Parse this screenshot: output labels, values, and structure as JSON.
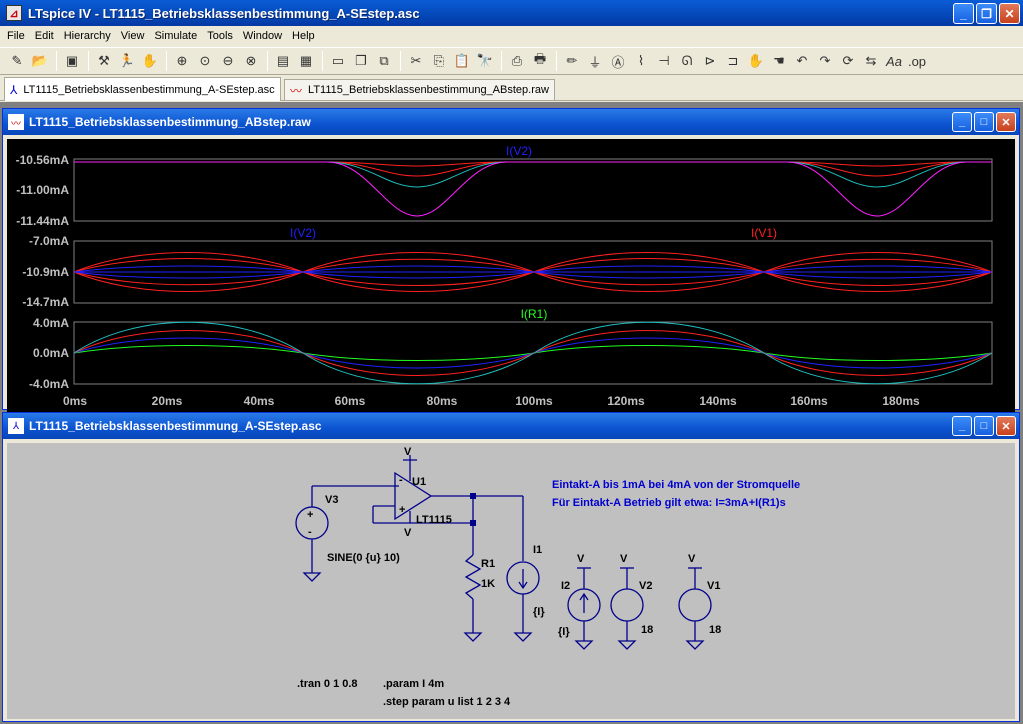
{
  "app": {
    "title": "LTspice IV - LT1115_Betriebsklassenbestimmung_A-SEstep.asc",
    "window_buttons": [
      "minimize-icon",
      "restore-icon",
      "close-icon"
    ]
  },
  "menu": [
    "File",
    "Edit",
    "Hierarchy",
    "View",
    "Simulate",
    "Tools",
    "Window",
    "Help"
  ],
  "toolbar_icons": [
    "new-schematic-icon",
    "open-icon",
    "save-icon",
    "control-panel-icon",
    "run-icon",
    "halt-icon",
    "zoom-in-icon",
    "zoom-pan-icon",
    "zoom-out-icon",
    "zoom-cancel-icon",
    "autorange-icon",
    "grid-icon",
    "tile-horizontal-icon",
    "cascade-icon",
    "close-window-icon",
    "cut-icon",
    "copy-icon",
    "paste-icon",
    "find-icon",
    "print-preview-icon",
    "print-icon",
    "wire-icon",
    "ground-icon",
    "label-icon",
    "resistor-icon",
    "capacitor-icon",
    "inductor-icon",
    "diode-icon",
    "component-icon",
    "move-icon",
    "drag-icon",
    "undo-icon",
    "redo-icon",
    "rotate-icon",
    "mirror-icon",
    "text-icon",
    "spice-directive-icon"
  ],
  "tabs": [
    {
      "label": "LT1115_Betriebsklassenbestimmung_A-SEstep.asc",
      "icon": "schematic-icon",
      "active": true
    },
    {
      "label": "LT1115_Betriebsklassenbestimmung_ABstep.raw",
      "icon": "waveform-icon",
      "active": false
    }
  ],
  "plot_window": {
    "title": "LT1115_Betriebsklassenbestimmung_ABstep.raw",
    "background": "#000000",
    "panes": [
      {
        "traces": [
          {
            "label": "I(V2)",
            "color": "#2020ff"
          }
        ],
        "yticks": [
          "-10.56mA",
          "-11.00mA",
          "-11.44mA"
        ]
      },
      {
        "traces": [
          {
            "label": "I(V2)",
            "color": "#2020ff"
          },
          {
            "label": "I(V1)",
            "color": "#ff2020"
          }
        ],
        "yticks": [
          "-7.0mA",
          "-10.9mA",
          "-14.7mA"
        ]
      },
      {
        "traces": [
          {
            "label": "I(R1)",
            "color": "#20ff20"
          }
        ],
        "yticks": [
          "4.0mA",
          "0.0mA",
          "-4.0mA"
        ]
      }
    ],
    "xticks": [
      "0ms",
      "20ms",
      "40ms",
      "60ms",
      "80ms",
      "100ms",
      "120ms",
      "140ms",
      "160ms",
      "180ms"
    ]
  },
  "schematic_window": {
    "title": "LT1115_Betriebsklassenbestimmung_A-SEstep.asc",
    "background": "#c0c0c0",
    "comment_lines": [
      "Eintakt-A bis 1mA bei 4mA von der Stromquelle",
      "Für Eintakt-A Betrieb gilt etwa: I=3mA+I(R1)s"
    ],
    "labels": {
      "v3": "V3",
      "v3_value": "SINE(0 {u} 10)",
      "u1": "U1",
      "u1_part": "LT1115",
      "r1": "R1",
      "r1_value": "1K",
      "i1": "I1",
      "i1_value": "{I}",
      "i2": "I2",
      "i2_value": "{I}",
      "v2": "V2",
      "v2_value": "18",
      "v1": "V1",
      "v1_value": "18",
      "vplus": "V",
      "plus": "+",
      "minus": "-"
    },
    "directives": [
      ".tran 0 1 0.8",
      ".param I 4m",
      ".step param u list 1 2 3 4"
    ]
  }
}
